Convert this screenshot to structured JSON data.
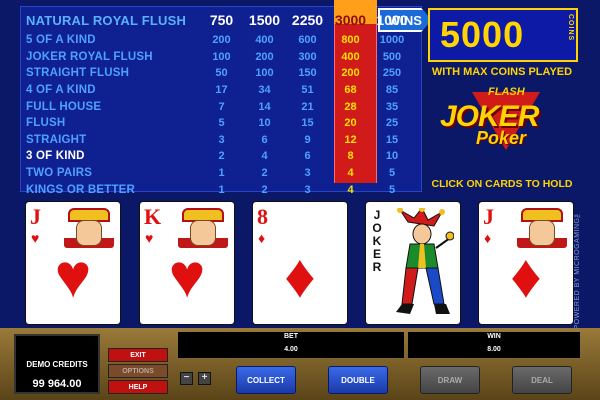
{
  "paytable": {
    "columns": [
      "750",
      "1500",
      "2250",
      "3000",
      "1000"
    ],
    "header_hand": "NATURAL ROYAL FLUSH",
    "rows": [
      {
        "hand": "5 OF A KIND",
        "payouts": [
          "200",
          "400",
          "600",
          "800",
          "1000"
        ]
      },
      {
        "hand": "JOKER ROYAL FLUSH",
        "payouts": [
          "100",
          "200",
          "300",
          "400",
          "500"
        ]
      },
      {
        "hand": "STRAIGHT FLUSH",
        "payouts": [
          "50",
          "100",
          "150",
          "200",
          "250"
        ]
      },
      {
        "hand": "4 OF A KIND",
        "payouts": [
          "17",
          "34",
          "51",
          "68",
          "85"
        ]
      },
      {
        "hand": "FULL HOUSE",
        "payouts": [
          "7",
          "14",
          "21",
          "28",
          "35"
        ]
      },
      {
        "hand": "FLUSH",
        "payouts": [
          "5",
          "10",
          "15",
          "20",
          "25"
        ]
      },
      {
        "hand": "STRAIGHT",
        "payouts": [
          "3",
          "6",
          "9",
          "12",
          "15"
        ]
      },
      {
        "hand": "3 OF KIND",
        "payouts": [
          "2",
          "4",
          "6",
          "8",
          "10"
        ]
      },
      {
        "hand": "TWO PAIRS",
        "payouts": [
          "1",
          "2",
          "3",
          "4",
          "5"
        ]
      },
      {
        "hand": "KINGS OR BETTER",
        "payouts": [
          "1",
          "2",
          "3",
          "4",
          "5"
        ]
      }
    ],
    "highlight_hand": "3 OF KIND",
    "selected_column": "3000"
  },
  "wins_tag": "WINS",
  "win_display": {
    "amount": "5000",
    "coins_label": "COINS"
  },
  "max_coins_text": "WITH MAX COINS PLAYED",
  "logo": {
    "flash": "FLASH",
    "joker": "JOKER",
    "poker": "Poker"
  },
  "hold_hint": "CLICK ON CARDS TO HOLD",
  "cards": [
    {
      "rank": "J",
      "suit": "♥",
      "color": "red",
      "name": "jack-of-hearts"
    },
    {
      "rank": "K",
      "suit": "♥",
      "color": "red",
      "name": "king-of-hearts"
    },
    {
      "rank": "8",
      "suit": "♦",
      "color": "red",
      "name": "eight-of-diamonds"
    },
    {
      "rank": "JOKER",
      "suit": "",
      "color": "black",
      "name": "joker"
    },
    {
      "rank": "J",
      "suit": "♦",
      "color": "red",
      "name": "jack-of-diamonds"
    }
  ],
  "powered_by": "POWERED BY MICROGAMING™",
  "panel": {
    "credits_label": "DEMO CREDITS",
    "credits_value": "99 964.00",
    "exit": "EXIT",
    "options": "OPTIONS",
    "help": "HELP",
    "minus": "−",
    "plus": "+",
    "bet_label": "BET",
    "bet_value": "4.00",
    "win_label": "WIN",
    "win_value": "8.00",
    "collect": "COLLECT",
    "double": "DOUBLE",
    "draw": "DRAW",
    "deal": "DEAL"
  },
  "colors": {
    "accent_yellow": "#ffd400",
    "selected_column_red": "#d11a1a",
    "table_blue": "#0f2190",
    "hand_label_blue": "#4ea0ff"
  }
}
